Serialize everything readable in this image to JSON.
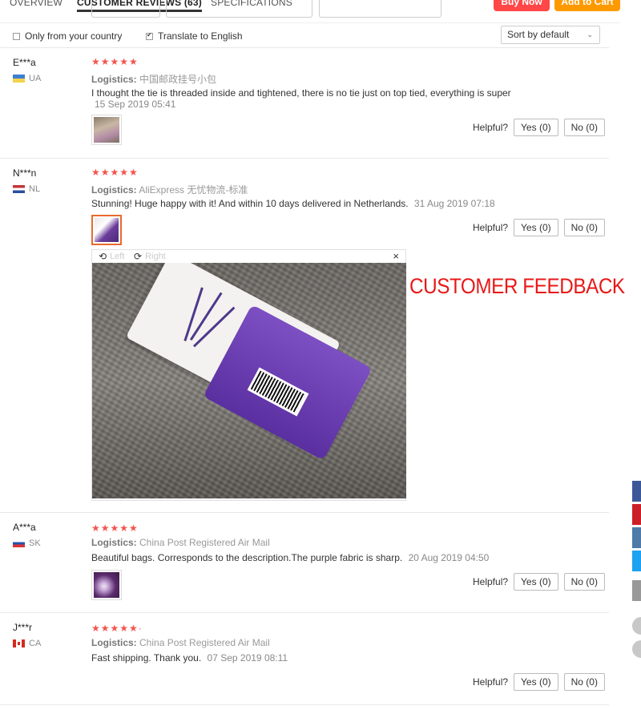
{
  "tabs": {
    "overview": "OVERVIEW",
    "customer_reviews": "CUSTOMER REVIEWS (63)",
    "specifications": "SPECIFICATIONS"
  },
  "actions": {
    "buy_now": "Buy Now",
    "add_to_cart": "Add to Cart"
  },
  "filters": {
    "only_country": "Only from your country",
    "only_country_checked": false,
    "translate": "Translate to English",
    "translate_checked": true,
    "sort": "Sort by default"
  },
  "labels": {
    "logistics": "Logistics:",
    "helpful": "Helpful?",
    "yes": "Yes (0)",
    "no": "No (0)"
  },
  "reviews": [
    {
      "user": "E***a",
      "country": "UA",
      "stars": "★★★★★",
      "logistics": "中国邮政挂号小包",
      "text": "I thought the tie is threaded inside and tightened, there is no tie just on top tied, everything is super",
      "date": "15 Sep 2019 05:41"
    },
    {
      "user": "N***n",
      "country": "NL",
      "stars": "★★★★★",
      "logistics": "AliExpress 无忧物流-标准",
      "text": "Stunning! Huge happy with it! And within 10 days delivered in Netherlands.",
      "date": "31 Aug 2019 07:18"
    },
    {
      "user": "A***a",
      "country": "SK",
      "stars": "★★★★★",
      "logistics": "China Post Registered Air Mail",
      "text": "Beautiful bags. Corresponds to the description.The purple fabric is sharp.",
      "date": "20 Aug 2019 04:50"
    },
    {
      "user": "J***r",
      "country": "CA",
      "stars": "★★★★★·",
      "logistics": "China Post Registered Air Mail",
      "text": "Fast shipping. Thank you.",
      "date": "07 Sep 2019 08:11"
    }
  ],
  "viewer": {
    "rotate_left": "Left",
    "rotate_right": "Right",
    "close": "×",
    "left_icon": "rotate-left-icon",
    "right_icon": "rotate-right-icon"
  },
  "overlay": {
    "caption": "CUSTOMER FEEDBACK",
    "color": "#e81818"
  },
  "colors": {
    "buy_now": "#ff4747",
    "add_to_cart": "#ff9900",
    "stars": "#f5534e"
  }
}
